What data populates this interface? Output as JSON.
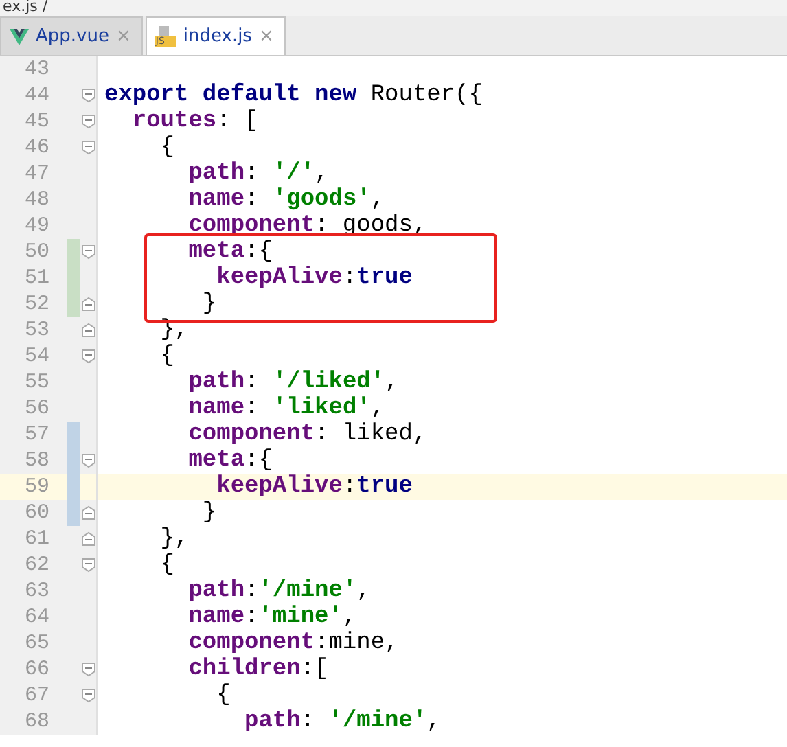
{
  "breadcrumb": "ex.js /",
  "tabs": [
    {
      "label": "App.vue",
      "kind": "vue",
      "close": "×",
      "selected": false
    },
    {
      "label": "index.js",
      "kind": "js",
      "badge": "JS",
      "close": "×",
      "selected": true
    }
  ],
  "lines": [
    {
      "number": "43",
      "kind": "text",
      "current": false,
      "boxed": false
    },
    {
      "number": "44",
      "kind": "fold-open",
      "tokens": [
        {
          "kind": "kw",
          "text": "export default new"
        },
        {
          "kind": "plain",
          "text": " Router({"
        }
      ],
      "current": false,
      "boxed": false
    },
    {
      "number": "45",
      "kind": "fold-open",
      "tokens": [
        {
          "kind": "prop",
          "text": "  routes"
        },
        {
          "kind": "plain",
          "text": ": ["
        }
      ],
      "current": false,
      "boxed": false
    },
    {
      "number": "46",
      "kind": "fold-open",
      "tokens": [
        {
          "kind": "plain",
          "text": "    {"
        }
      ],
      "current": false,
      "boxed": false
    },
    {
      "number": "47",
      "kind": "text",
      "tokens": [
        {
          "kind": "prop",
          "text": "      path"
        },
        {
          "kind": "plain",
          "text": ": "
        },
        {
          "kind": "str",
          "text": "'/'"
        },
        {
          "kind": "plain",
          "text": ","
        }
      ],
      "current": false,
      "boxed": false
    },
    {
      "number": "48",
      "kind": "text",
      "tokens": [
        {
          "kind": "prop",
          "text": "      name"
        },
        {
          "kind": "plain",
          "text": ": "
        },
        {
          "kind": "str",
          "text": "'goods'"
        },
        {
          "kind": "plain",
          "text": ","
        }
      ],
      "current": false,
      "boxed": false
    },
    {
      "number": "49",
      "kind": "text",
      "tokens": [
        {
          "kind": "prop",
          "text": "      component"
        },
        {
          "kind": "plain",
          "text": ": goods,"
        }
      ],
      "current": false,
      "boxed": false
    },
    {
      "number": "50",
      "kind": "fold-open",
      "color": "#c9dfc5",
      "tokens": [
        {
          "kind": "prop",
          "text": "      meta"
        },
        {
          "kind": "plain",
          "text": ":{"
        }
      ],
      "current": false,
      "boxed": true
    },
    {
      "number": "51",
      "kind": "text",
      "color": "#c9dfc5",
      "tokens": [
        {
          "kind": "prop",
          "text": "        keepAlive"
        },
        {
          "kind": "plain",
          "text": ":"
        },
        {
          "kind": "kw",
          "text": "true"
        }
      ],
      "current": false,
      "boxed": true
    },
    {
      "number": "52",
      "kind": "fold-close",
      "color": "#c9dfc5",
      "tokens": [
        {
          "kind": "plain",
          "text": "       }"
        }
      ],
      "current": false,
      "boxed": true
    },
    {
      "number": "53",
      "kind": "fold-close",
      "tokens": [
        {
          "kind": "plain",
          "text": "    },"
        }
      ],
      "current": false,
      "boxed": false
    },
    {
      "number": "54",
      "kind": "fold-open",
      "tokens": [
        {
          "kind": "plain",
          "text": "    {"
        }
      ],
      "current": false,
      "boxed": false
    },
    {
      "number": "55",
      "kind": "text",
      "tokens": [
        {
          "kind": "prop",
          "text": "      path"
        },
        {
          "kind": "plain",
          "text": ": "
        },
        {
          "kind": "str",
          "text": "'/liked'"
        },
        {
          "kind": "plain",
          "text": ","
        }
      ],
      "current": false,
      "boxed": false
    },
    {
      "number": "56",
      "kind": "text",
      "tokens": [
        {
          "kind": "prop",
          "text": "      name"
        },
        {
          "kind": "plain",
          "text": ": "
        },
        {
          "kind": "str",
          "text": "'liked'"
        },
        {
          "kind": "plain",
          "text": ","
        }
      ],
      "current": false,
      "boxed": false
    },
    {
      "number": "57",
      "kind": "text",
      "color": "#c0d3e6",
      "tokens": [
        {
          "kind": "prop",
          "text": "      component"
        },
        {
          "kind": "plain",
          "text": ": liked,"
        }
      ],
      "current": false,
      "boxed": false
    },
    {
      "number": "58",
      "kind": "fold-open",
      "color": "#c0d3e6",
      "tokens": [
        {
          "kind": "prop",
          "text": "      meta"
        },
        {
          "kind": "plain",
          "text": ":{"
        }
      ],
      "current": false,
      "boxed": false
    },
    {
      "number": "59",
      "kind": "text",
      "color": "#c0d3e6",
      "tokens": [
        {
          "kind": "prop",
          "text": "        keepAlive"
        },
        {
          "kind": "plain",
          "text": ":"
        },
        {
          "kind": "kw",
          "text": "true"
        }
      ],
      "current": true,
      "boxed": false
    },
    {
      "number": "60",
      "kind": "fold-close",
      "color": "#c0d3e6",
      "tokens": [
        {
          "kind": "plain",
          "text": "       }"
        }
      ],
      "current": false,
      "boxed": false
    },
    {
      "number": "61",
      "kind": "fold-close",
      "tokens": [
        {
          "kind": "plain",
          "text": "    },"
        }
      ],
      "current": false,
      "boxed": false
    },
    {
      "number": "62",
      "kind": "fold-open",
      "tokens": [
        {
          "kind": "plain",
          "text": "    {"
        }
      ],
      "current": false,
      "boxed": false
    },
    {
      "number": "63",
      "kind": "text",
      "tokens": [
        {
          "kind": "prop",
          "text": "      path"
        },
        {
          "kind": "plain",
          "text": ":"
        },
        {
          "kind": "str",
          "text": "'/mine'"
        },
        {
          "kind": "plain",
          "text": ","
        }
      ],
      "current": false,
      "boxed": false
    },
    {
      "number": "64",
      "kind": "text",
      "tokens": [
        {
          "kind": "prop",
          "text": "      name"
        },
        {
          "kind": "plain",
          "text": ":"
        },
        {
          "kind": "str",
          "text": "'mine'"
        },
        {
          "kind": "plain",
          "text": ","
        }
      ],
      "current": false,
      "boxed": false
    },
    {
      "number": "65",
      "kind": "text",
      "tokens": [
        {
          "kind": "prop",
          "text": "      component"
        },
        {
          "kind": "plain",
          "text": ":mine,"
        }
      ],
      "current": false,
      "boxed": false
    },
    {
      "number": "66",
      "kind": "fold-open",
      "tokens": [
        {
          "kind": "prop",
          "text": "      children"
        },
        {
          "kind": "plain",
          "text": ":["
        }
      ],
      "current": false,
      "boxed": false
    },
    {
      "number": "67",
      "kind": "fold-open",
      "tokens": [
        {
          "kind": "plain",
          "text": "        {"
        }
      ],
      "current": false,
      "boxed": false
    },
    {
      "number": "68",
      "kind": "text",
      "tokens": [
        {
          "kind": "prop",
          "text": "          path"
        },
        {
          "kind": "plain",
          "text": ": "
        },
        {
          "kind": "str",
          "text": "'/mine'"
        },
        {
          "kind": "plain",
          "text": ","
        }
      ],
      "current": false,
      "boxed": false
    }
  ]
}
